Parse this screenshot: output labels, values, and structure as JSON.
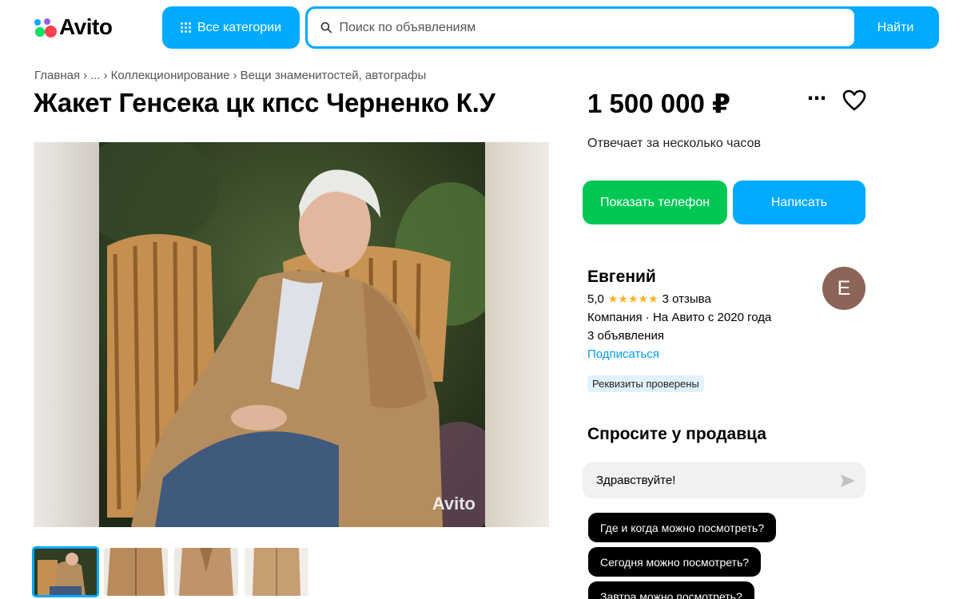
{
  "header": {
    "logo_text": "Avito",
    "categories_label": "Все категории",
    "search_placeholder": "Поиск по объявлениям",
    "search_button": "Найти"
  },
  "breadcrumbs": [
    "Главная",
    "›",
    "...",
    "›",
    "Коллекционирование",
    "›",
    "Вещи знаменитостей, автографы"
  ],
  "listing": {
    "title": "Жакет Генсека цк кпсс Черненко К.У",
    "watermark": "Avito",
    "thumbnails_count": 4
  },
  "sidebar": {
    "price": "1 500 000 ₽",
    "reply_time": "Отвечает за несколько часов",
    "show_phone": "Показать телефон",
    "write": "Написать"
  },
  "seller": {
    "name": "Евгений",
    "avatar_letter": "Е",
    "rating": "5,0",
    "stars": "★★★★★",
    "reviews": "3 отзыва",
    "info": "Компания · На Авито с 2020 года",
    "ads": "3 объявления",
    "subscribe": "Подписаться",
    "verified": "Реквизиты проверены"
  },
  "ask": {
    "title": "Спросите у продавца",
    "message_value": "Здравствуйте!",
    "chips": [
      "Где и когда можно посмотреть?",
      "Сегодня можно посмотреть?",
      "Завтра можно посмотреть?"
    ]
  },
  "colors": {
    "accent": "#00aaff",
    "phone_button": "#00c853",
    "stars": "#ffb021",
    "link": "#009cf0",
    "avatar": "#8c6558"
  },
  "icons": [
    "avito-logo-icon",
    "grid-icon",
    "search-icon",
    "more-icon",
    "heart-icon",
    "send-icon"
  ]
}
